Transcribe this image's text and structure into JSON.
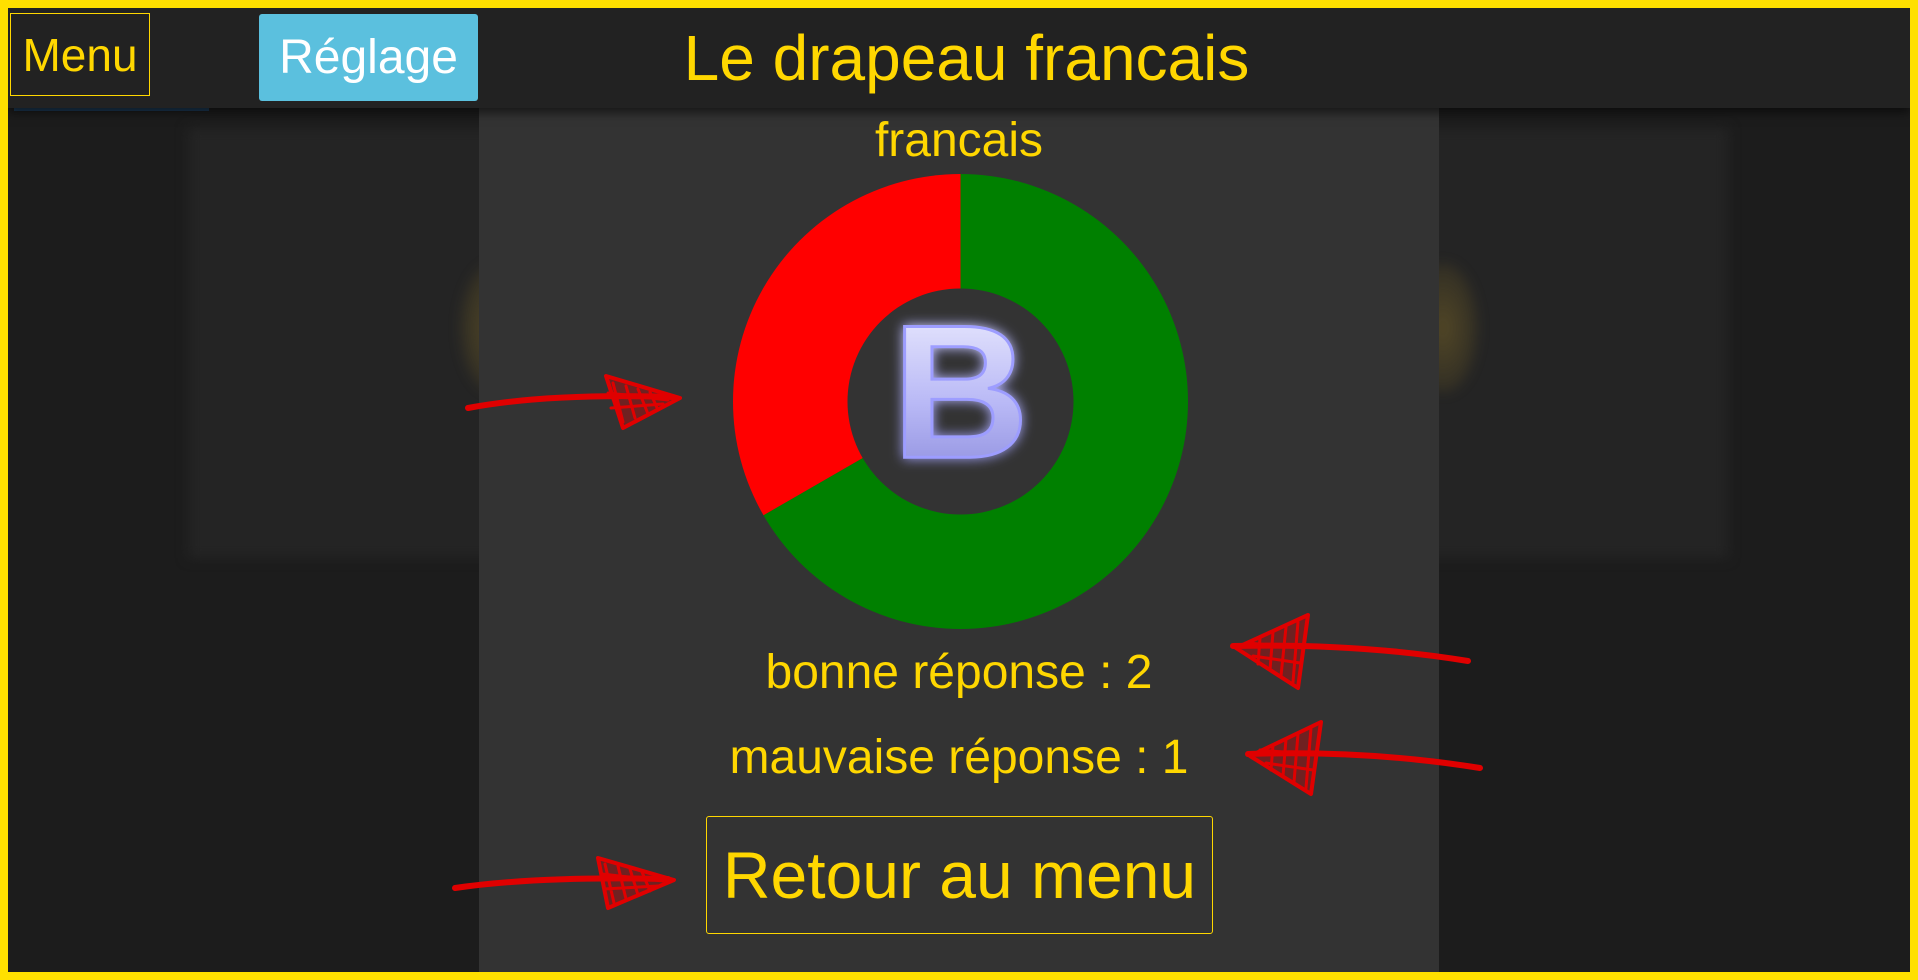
{
  "header": {
    "menu_label": "Menu",
    "settings_label": "Réglage",
    "title": "Le drapeau francais"
  },
  "panel": {
    "subtitle": "francais",
    "grade_letter": "B",
    "good_answers_text": "bonne réponse : 2",
    "bad_answers_text": "mauvaise réponse : 1",
    "return_label": "Retour au menu"
  },
  "results": {
    "good": 2,
    "bad": 1
  },
  "colors": {
    "accent": "#ffd700",
    "good": "#008000",
    "bad": "#ff0000",
    "settings_button": "#5bc0de",
    "annotation_arrows": "#e00000"
  },
  "icons": {
    "grade_badge": "letter-b-icon",
    "annotations": "hand-drawn-red-arrow-icon"
  }
}
